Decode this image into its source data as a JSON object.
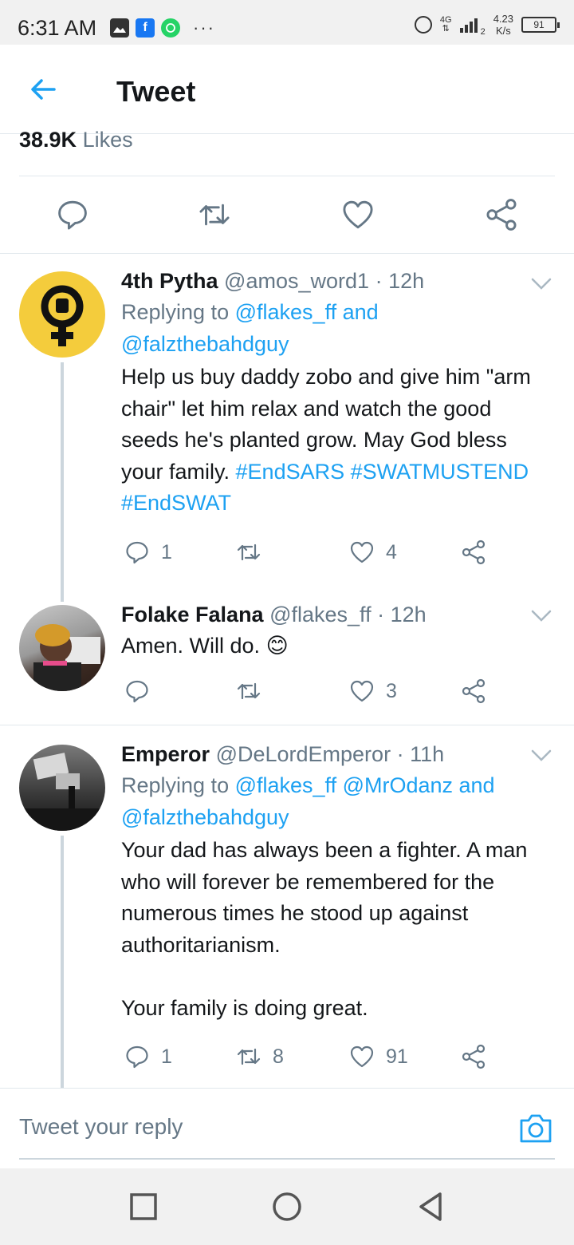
{
  "status_bar": {
    "time": "6:31 AM",
    "more": "···",
    "network": "4G",
    "sim_slot": "2",
    "speed_value": "4.23",
    "speed_unit": "K/s",
    "battery": "91"
  },
  "header": {
    "title": "Tweet"
  },
  "main_tweet": {
    "likes_count": "38.9K",
    "likes_label": "Likes"
  },
  "tweets": [
    {
      "name": "4th Pytha",
      "handle": "@amos_word1",
      "time": "12h",
      "replying_prefix": "Replying to ",
      "replying_mentions_line1": "@flakes_ff and",
      "replying_mentions_line2": "@falzthebahdguy",
      "text": "Help us buy daddy zobo and give him \"arm chair\" let him relax and watch the good seeds he's planted grow. May God bless your family. ",
      "hashtag1": "#EndSARS",
      "hashtag2": "#SWATMUSTEND",
      "hashtag3": "#EndSWAT",
      "replies": "1",
      "retweets": "",
      "likes": "4"
    },
    {
      "name": "Folake Falana",
      "handle": "@flakes_ff",
      "time": "12h",
      "text": "Amen. Will do. ",
      "emoji": "😊",
      "replies": "",
      "retweets": "",
      "likes": "3"
    },
    {
      "name": "Emperor",
      "handle": "@DeLordEmperor",
      "time": "11h",
      "replying_prefix": "Replying to ",
      "replying_mentions_line1": "@flakes_ff @MrOdanz and",
      "replying_mentions_line2": "@falzthebahdguy",
      "text": "Your dad has always been a fighter. A man who will forever be remembered for the numerous times he stood up against authoritarianism.\n\nYour family is doing great.",
      "replies": "1",
      "retweets": "8",
      "likes": "91"
    }
  ],
  "reply_bar": {
    "placeholder": "Tweet your reply"
  },
  "colors": {
    "accent": "#1da1f2",
    "secondary_text": "#657786",
    "divider": "#e1e8ed"
  },
  "icons": [
    "back-arrow-icon",
    "reply-icon",
    "retweet-icon",
    "like-icon",
    "share-icon",
    "chevron-down-icon",
    "camera-icon"
  ]
}
